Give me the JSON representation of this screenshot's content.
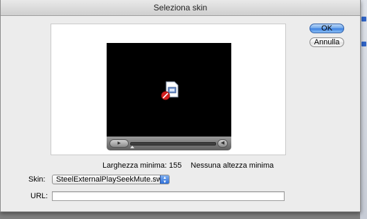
{
  "dialog": {
    "title": "Seleziona skin",
    "ok_label": "OK",
    "cancel_label": "Annulla"
  },
  "preview": {
    "play_glyph": "▶",
    "volume_glyph": "◀",
    "plugin_icon": "missing-plugin-icon"
  },
  "size_info": {
    "min_width": "Larghezza minima: 155",
    "min_height": "Nessuna altezza minima"
  },
  "skin": {
    "label": "Skin:",
    "selected": "SteelExternalPlaySeekMute.swf"
  },
  "url": {
    "label": "URL:",
    "value": ""
  },
  "colors": {
    "accent": "#3a7ee0",
    "video_bg": "#000000"
  }
}
